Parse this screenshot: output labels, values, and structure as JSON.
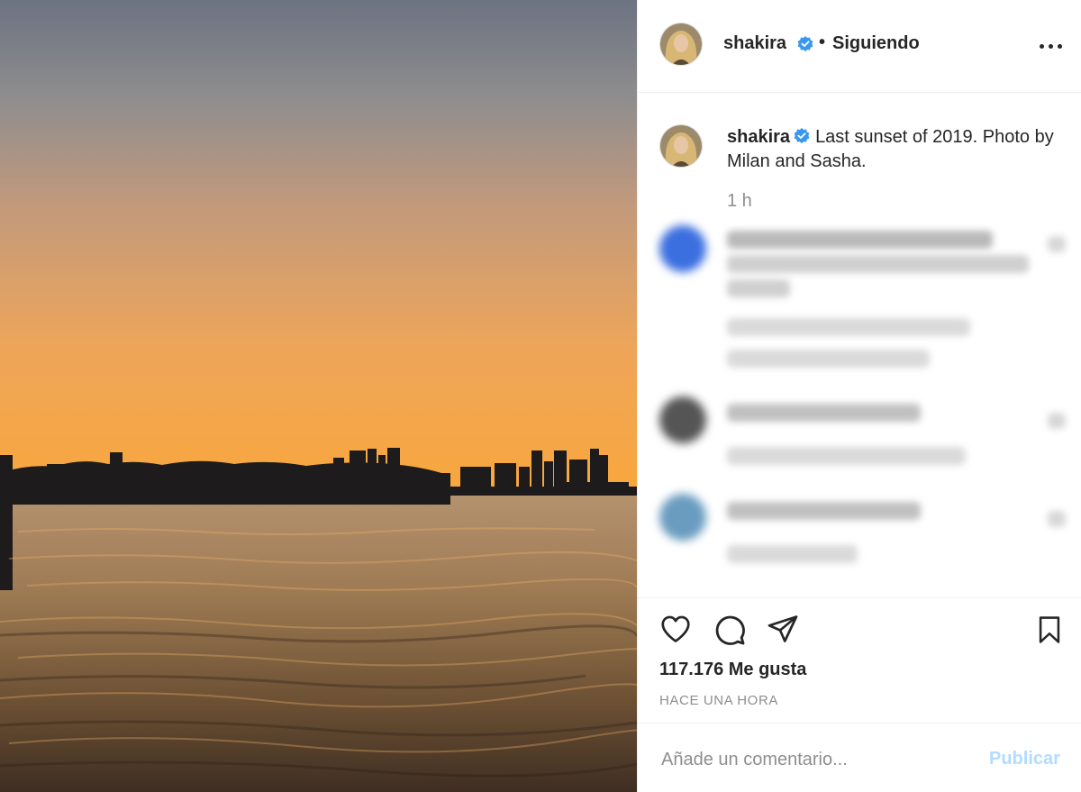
{
  "post": {
    "author": {
      "username": "shakira",
      "verified": true,
      "follow_status": "Siguiendo",
      "separator": "•"
    },
    "caption": {
      "username": "shakira",
      "text": "Last sunset of 2019. Photo by Milan and Sasha.",
      "time": "1 h"
    },
    "comments": [
      {
        "blurred": true,
        "avatar_color": "#3b6fe0"
      },
      {
        "blurred": true,
        "avatar_color": "#555555"
      },
      {
        "blurred": true,
        "avatar_color": "#6a9cc0"
      }
    ],
    "actions": {
      "icons": [
        "heart-icon",
        "comment-icon",
        "share-icon",
        "bookmark-icon"
      ],
      "likes": "117.176 Me gusta",
      "timestamp": "HACE UNA HORA"
    },
    "add_comment": {
      "placeholder": "Añade un comentario...",
      "submit_label": "Publicar"
    }
  },
  "colors": {
    "verified_badge": "#3897f0",
    "publish_disabled": "#b3dbff",
    "secondary_text": "#8e8e8e",
    "sunset_orange": "#f7a544"
  }
}
